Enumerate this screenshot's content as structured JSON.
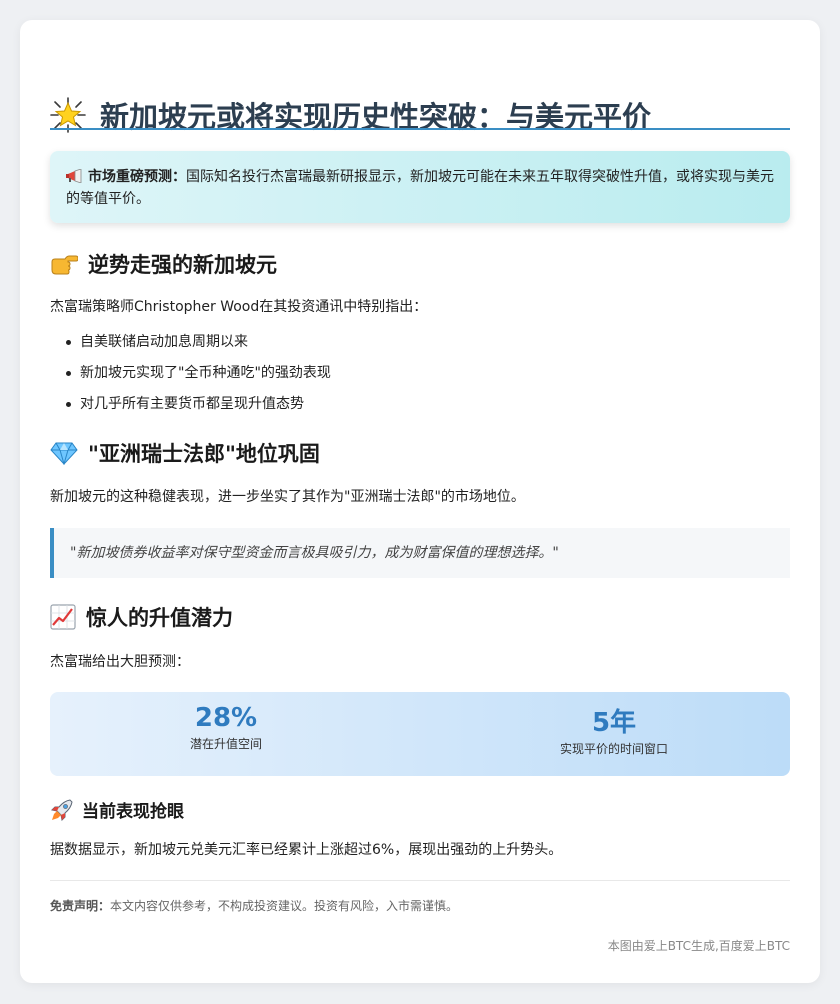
{
  "title": "新加坡元或将实现历史性突破：与美元平价",
  "alert": {
    "label": "市场重磅预测：",
    "text": "国际知名投行杰富瑞最新研报显示，新加坡元可能在未来五年取得突破性升值，或将实现与美元的等值平价。"
  },
  "section1": {
    "heading": "逆势走强的新加坡元",
    "intro": "杰富瑞策略师Christopher Wood在其投资通讯中特别指出：",
    "bullets": [
      "自美联储启动加息周期以来",
      "新加坡元实现了\"全币种通吃\"的强劲表现",
      "对几乎所有主要货币都呈现升值态势"
    ]
  },
  "section2": {
    "heading": "\"亚洲瑞士法郎\"地位巩固",
    "text": "新加坡元的这种稳健表现，进一步坐实了其作为\"亚洲瑞士法郎\"的市场地位。",
    "quote": "\"新加坡债券收益率对保守型资金而言极具吸引力，成为财富保值的理想选择。\""
  },
  "section3": {
    "heading": "惊人的升值潜力",
    "intro": "杰富瑞给出大胆预测：",
    "stats": [
      {
        "value": "28%",
        "label": "潜在升值空间"
      },
      {
        "value": "5年",
        "label": "实现平价的时间窗口"
      }
    ]
  },
  "section4": {
    "heading": "当前表现抢眼",
    "text": "据数据显示，新加坡元兑美元汇率已经累计上涨超过6%，展现出强劲的上升势头。"
  },
  "footer": {
    "disclaimer_label": "免责声明：",
    "disclaimer_text": "本文内容仅供参考，不构成投资建议。投资有风险，入市需谨慎。",
    "credit": "本图由爱上BTC生成,百度爱上BTC"
  },
  "icons": {
    "title": "star-icon",
    "alert": "megaphone-icon",
    "section1": "pointing-hand-icon",
    "section2": "gem-icon",
    "section3": "chart-increasing-icon",
    "section4": "rocket-icon"
  },
  "colors": {
    "accent": "#3a8ec4",
    "stat_number": "#2f7bbf",
    "title": "#2c3e50"
  }
}
